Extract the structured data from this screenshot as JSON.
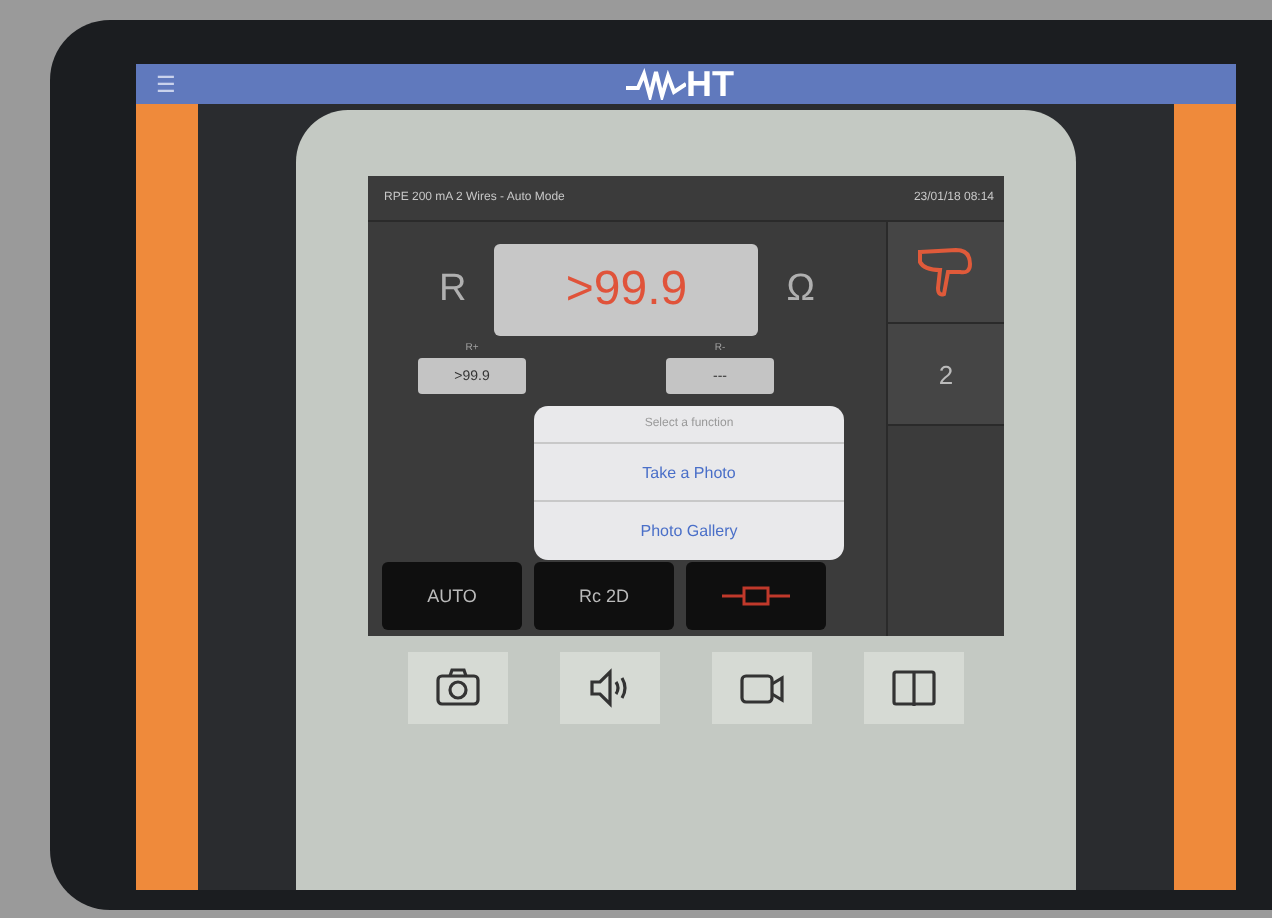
{
  "app_bar": {
    "menu_icon": "☰",
    "logo": "HT"
  },
  "display": {
    "title": "RPE 200 mA 2 Wires - Auto Mode",
    "datetime": "23/01/18 08:14",
    "main_reading": {
      "symbol": "R",
      "value": ">99.9",
      "unit": "Ω"
    },
    "sub_readings": [
      {
        "label": "R+",
        "value": ">99.9"
      },
      {
        "label": "R-",
        "value": "---"
      }
    ],
    "side_count": "2",
    "mode_buttons": [
      {
        "label": "AUTO",
        "kind": "text"
      },
      {
        "label": "Rc 2D",
        "kind": "text"
      },
      {
        "kind": "resistor"
      }
    ]
  },
  "dialog": {
    "title": "Select a function",
    "actions": [
      "Take a Photo",
      "Photo Gallery"
    ]
  },
  "toolbar": [
    {
      "kind": "camera"
    },
    {
      "kind": "speaker"
    },
    {
      "kind": "video"
    },
    {
      "kind": "book"
    }
  ]
}
